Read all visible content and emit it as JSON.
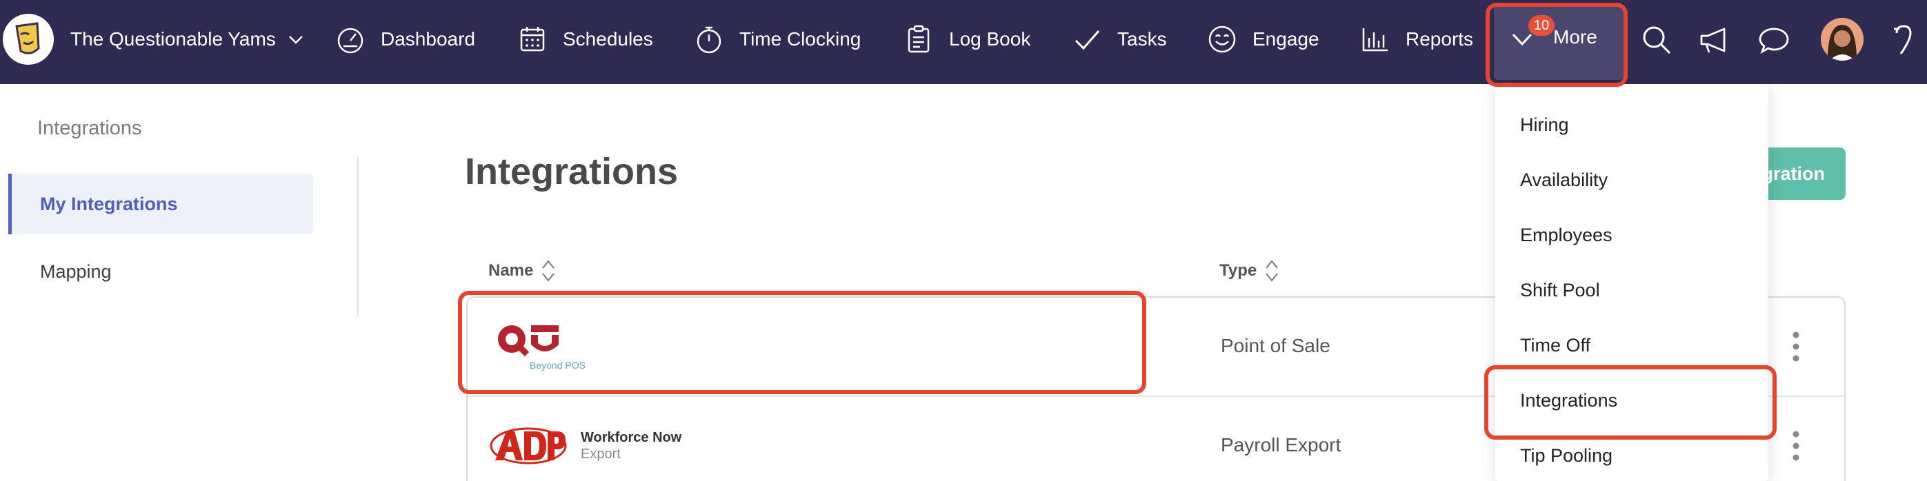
{
  "topbar": {
    "org_name": "The Questionable Yams",
    "nav": [
      {
        "label": "Dashboard",
        "icon": "gauge-icon"
      },
      {
        "label": "Schedules",
        "icon": "calendar-icon"
      },
      {
        "label": "Time Clocking",
        "icon": "stopwatch-icon"
      },
      {
        "label": "Log Book",
        "icon": "clipboard-icon"
      },
      {
        "label": "Tasks",
        "icon": "checkmark-icon"
      },
      {
        "label": "Engage",
        "icon": "smiley-icon"
      },
      {
        "label": "Reports",
        "icon": "bar-chart-icon"
      }
    ],
    "more_label": "More",
    "more_badge": "10",
    "right_icons": [
      "search-icon",
      "megaphone-icon",
      "chat-icon",
      "user-avatar",
      "app-logo-icon"
    ],
    "colors": {
      "bar": "#2f2a52",
      "badge": "#e8503a",
      "highlight": "#e5442f"
    }
  },
  "sidebar": {
    "title": "Integrations",
    "items": [
      {
        "label": "My Integrations",
        "active": true
      },
      {
        "label": "Mapping",
        "active": false
      }
    ]
  },
  "main": {
    "title": "Integrations",
    "add_button_visible_text": "gration",
    "columns": [
      "Name",
      "Type"
    ],
    "rows": [
      {
        "logo": "qu-beyond-pos-logo",
        "logo_caption": "Beyond POS",
        "type": "Point of Sale"
      },
      {
        "logo": "adp-logo",
        "product_name": "Workforce Now",
        "product_sub": "Export",
        "type": "Payroll Export"
      }
    ]
  },
  "more_menu": {
    "items": [
      "Hiring",
      "Availability",
      "Employees",
      "Shift Pool",
      "Time Off",
      "Integrations",
      "Tip Pooling"
    ],
    "highlighted": "Integrations"
  }
}
